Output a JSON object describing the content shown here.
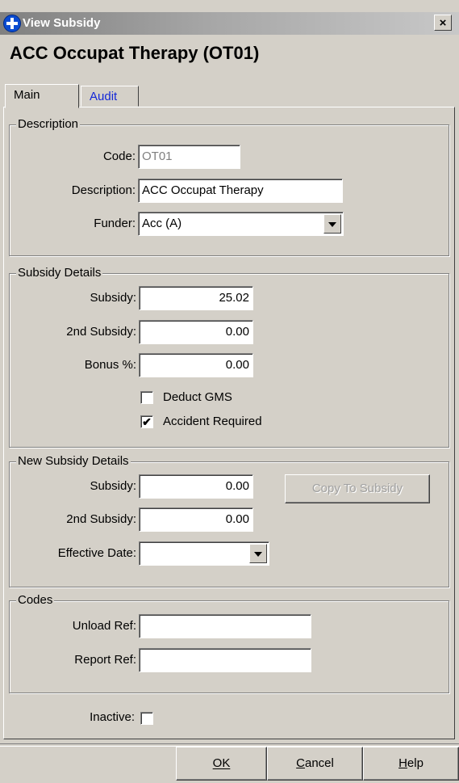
{
  "window": {
    "title": "View Subsidy",
    "close_label": "×"
  },
  "heading": "ACC Occupat Therapy (OT01)",
  "tabs": [
    {
      "label": "Main",
      "active": true
    },
    {
      "label": "Audit",
      "active": false
    }
  ],
  "description_group": {
    "title": "Description",
    "code_label": "Code:",
    "code_value": "OT01",
    "description_label": "Description:",
    "description_value": "ACC Occupat Therapy",
    "funder_label": "Funder:",
    "funder_value": "Acc (A)"
  },
  "subsidy_group": {
    "title": "Subsidy Details",
    "subsidy_label": "Subsidy:",
    "subsidy_value": "25.02",
    "second_label": "2nd Subsidy:",
    "second_value": "0.00",
    "bonus_label": "Bonus %:",
    "bonus_value": "0.00",
    "deduct_gms_label": "Deduct GMS",
    "deduct_gms_checked": false,
    "accident_label": "Accident Required",
    "accident_checked": true,
    "check_mark": "✔"
  },
  "new_subsidy_group": {
    "title": "New Subsidy Details",
    "subsidy_label": "Subsidy:",
    "subsidy_value": "0.00",
    "second_label": "2nd Subsidy:",
    "second_value": "0.00",
    "effective_label": "Effective Date:",
    "effective_value": "",
    "copy_button": "Copy To Subsidy"
  },
  "codes_group": {
    "title": "Codes",
    "unload_label": "Unload Ref:",
    "unload_value": "",
    "report_label": "Report Ref:",
    "report_value": ""
  },
  "inactive": {
    "label": "Inactive:",
    "checked": false
  },
  "buttons": {
    "ok": "OK",
    "cancel": "Cancel",
    "help": "Help"
  },
  "colors": {
    "face": "#d4d0c8",
    "titlebar": "#808080",
    "tab_link": "#1428d8",
    "disabled_text": "#808080"
  }
}
